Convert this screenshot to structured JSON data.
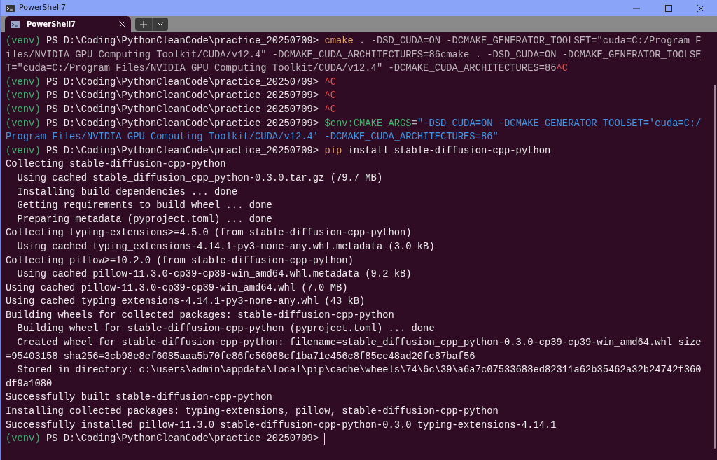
{
  "window": {
    "title": "PowerShell7"
  },
  "tabs": [
    {
      "label": "PowerShell7",
      "selected": true
    }
  ],
  "terminal": {
    "lines": [
      {
        "segments": [
          {
            "kind": "venv",
            "text": "(venv)"
          },
          {
            "kind": "prompt",
            "text": " PS D:\\Coding\\PythonCleanCode\\practice_20250709> "
          },
          {
            "kind": "command",
            "text": "cmake"
          },
          {
            "kind": "arg",
            "text": " . -DSD_CUDA=ON -DCMAKE_GENERATOR_TOOLSET=\"cuda=C:/Program F"
          }
        ]
      },
      {
        "segments": [
          {
            "kind": "arg",
            "text": "iles/NVIDIA GPU Computing Toolkit/CUDA/v12.4\" -DCMAKE_CUDA_ARCHITECTURES=86cmake . -DSD_CUDA=ON -DCMAKE_GENERATOR_TOOLSE"
          }
        ]
      },
      {
        "segments": [
          {
            "kind": "arg",
            "text": "T=\"cuda=C:/Program Files/NVIDIA GPU Computing Toolkit/CUDA/v12.4\" -DCMAKE_CUDA_ARCHITECTURES=86"
          },
          {
            "kind": "ctrl",
            "text": "^C"
          }
        ]
      },
      {
        "segments": [
          {
            "kind": "venv",
            "text": "(venv)"
          },
          {
            "kind": "prompt",
            "text": " PS D:\\Coding\\PythonCleanCode\\practice_20250709> "
          },
          {
            "kind": "ctrl",
            "text": "^C"
          }
        ]
      },
      {
        "segments": [
          {
            "kind": "venv",
            "text": "(venv)"
          },
          {
            "kind": "prompt",
            "text": " PS D:\\Coding\\PythonCleanCode\\practice_20250709> "
          },
          {
            "kind": "ctrl",
            "text": "^C"
          }
        ]
      },
      {
        "segments": [
          {
            "kind": "venv",
            "text": "(venv)"
          },
          {
            "kind": "prompt",
            "text": " PS D:\\Coding\\PythonCleanCode\\practice_20250709> "
          },
          {
            "kind": "ctrl",
            "text": "^C"
          }
        ]
      },
      {
        "segments": [
          {
            "kind": "venv",
            "text": "(venv)"
          },
          {
            "kind": "prompt",
            "text": " PS D:\\Coding\\PythonCleanCode\\practice_20250709> "
          },
          {
            "kind": "variable",
            "text": "$env:CMAKE_ARGS"
          },
          {
            "kind": "arg",
            "text": "="
          },
          {
            "kind": "string",
            "text": "\"-DSD_CUDA=ON -DCMAKE_GENERATOR_TOOLSET='cuda=C:/"
          }
        ]
      },
      {
        "segments": [
          {
            "kind": "string",
            "text": "Program Files/NVIDIA GPU Computing Toolkit/CUDA/v12.4' -DCMAKE_CUDA_ARCHITECTURES=86\""
          }
        ]
      },
      {
        "segments": [
          {
            "kind": "venv",
            "text": "(venv)"
          },
          {
            "kind": "prompt",
            "text": " PS D:\\Coding\\PythonCleanCode\\practice_20250709> "
          },
          {
            "kind": "command",
            "text": "pip"
          },
          {
            "kind": "output",
            "text": " install stable-diffusion-cpp-python"
          }
        ]
      },
      {
        "segments": [
          {
            "kind": "output",
            "text": "Collecting stable-diffusion-cpp-python"
          }
        ]
      },
      {
        "segments": [
          {
            "kind": "output",
            "text": "  Using cached stable_diffusion_cpp_python-0.3.0.tar.gz (79.7 MB)"
          }
        ]
      },
      {
        "segments": [
          {
            "kind": "output",
            "text": "  Installing build dependencies ... done"
          }
        ]
      },
      {
        "segments": [
          {
            "kind": "output",
            "text": "  Getting requirements to build wheel ... done"
          }
        ]
      },
      {
        "segments": [
          {
            "kind": "output",
            "text": "  Preparing metadata (pyproject.toml) ... done"
          }
        ]
      },
      {
        "segments": [
          {
            "kind": "output",
            "text": "Collecting typing-extensions>=4.5.0 (from stable-diffusion-cpp-python)"
          }
        ]
      },
      {
        "segments": [
          {
            "kind": "output",
            "text": "  Using cached typing_extensions-4.14.1-py3-none-any.whl.metadata (3.0 kB)"
          }
        ]
      },
      {
        "segments": [
          {
            "kind": "output",
            "text": "Collecting pillow>=10.2.0 (from stable-diffusion-cpp-python)"
          }
        ]
      },
      {
        "segments": [
          {
            "kind": "output",
            "text": "  Using cached pillow-11.3.0-cp39-cp39-win_amd64.whl.metadata (9.2 kB)"
          }
        ]
      },
      {
        "segments": [
          {
            "kind": "output",
            "text": "Using cached pillow-11.3.0-cp39-cp39-win_amd64.whl (7.0 MB)"
          }
        ]
      },
      {
        "segments": [
          {
            "kind": "output",
            "text": "Using cached typing_extensions-4.14.1-py3-none-any.whl (43 kB)"
          }
        ]
      },
      {
        "segments": [
          {
            "kind": "output",
            "text": "Building wheels for collected packages: stable-diffusion-cpp-python"
          }
        ]
      },
      {
        "segments": [
          {
            "kind": "output",
            "text": "  Building wheel for stable-diffusion-cpp-python (pyproject.toml) ... done"
          }
        ]
      },
      {
        "segments": [
          {
            "kind": "output",
            "text": "  Created wheel for stable-diffusion-cpp-python: filename=stable_diffusion_cpp_python-0.3.0-cp39-cp39-win_amd64.whl size"
          }
        ]
      },
      {
        "segments": [
          {
            "kind": "output",
            "text": "=95403158 sha256=3cb98e8ef6085aaa5b70fe86fc56068cf1ba71e456c8f85ce48ad20fc87baf56"
          }
        ]
      },
      {
        "segments": [
          {
            "kind": "output",
            "text": "  Stored in directory: c:\\users\\admin\\appdata\\local\\pip\\cache\\wheels\\74\\6c\\39\\a6a7c07533688ed82311a62b35462a32b24742f360"
          }
        ]
      },
      {
        "segments": [
          {
            "kind": "output",
            "text": "df9a1080"
          }
        ]
      },
      {
        "segments": [
          {
            "kind": "output",
            "text": "Successfully built stable-diffusion-cpp-python"
          }
        ]
      },
      {
        "segments": [
          {
            "kind": "output",
            "text": "Installing collected packages: typing-extensions, pillow, stable-diffusion-cpp-python"
          }
        ]
      },
      {
        "segments": [
          {
            "kind": "output",
            "text": "Successfully installed pillow-11.3.0 stable-diffusion-cpp-python-0.3.0 typing-extensions-4.14.1"
          }
        ]
      },
      {
        "segments": [
          {
            "kind": "venv",
            "text": "(venv)"
          },
          {
            "kind": "prompt",
            "text": " PS D:\\Coding\\PythonCleanCode\\practice_20250709> "
          }
        ],
        "cursor": true
      }
    ]
  }
}
